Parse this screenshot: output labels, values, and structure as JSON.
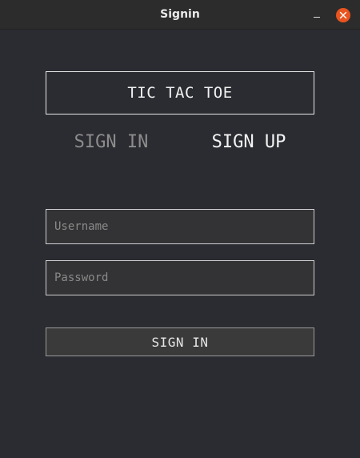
{
  "window": {
    "title": "Signin",
    "controls": {
      "minimize_icon": "minimize-icon",
      "close_icon": "close-icon",
      "close_color": "#e9541f"
    }
  },
  "banner": {
    "text": "TIC TAC TOE"
  },
  "tabs": [
    {
      "label": "SIGN IN",
      "active": false
    },
    {
      "label": "SIGN UP",
      "active": true
    }
  ],
  "form": {
    "username": {
      "value": "",
      "placeholder": "Username"
    },
    "password": {
      "value": "",
      "placeholder": "Password"
    },
    "submit_label": "SIGN IN"
  },
  "colors": {
    "background": "#2b2c31",
    "titlebar": "#2c2c2c",
    "text": "#f2f2f2",
    "muted_text": "#8c8c8c"
  }
}
